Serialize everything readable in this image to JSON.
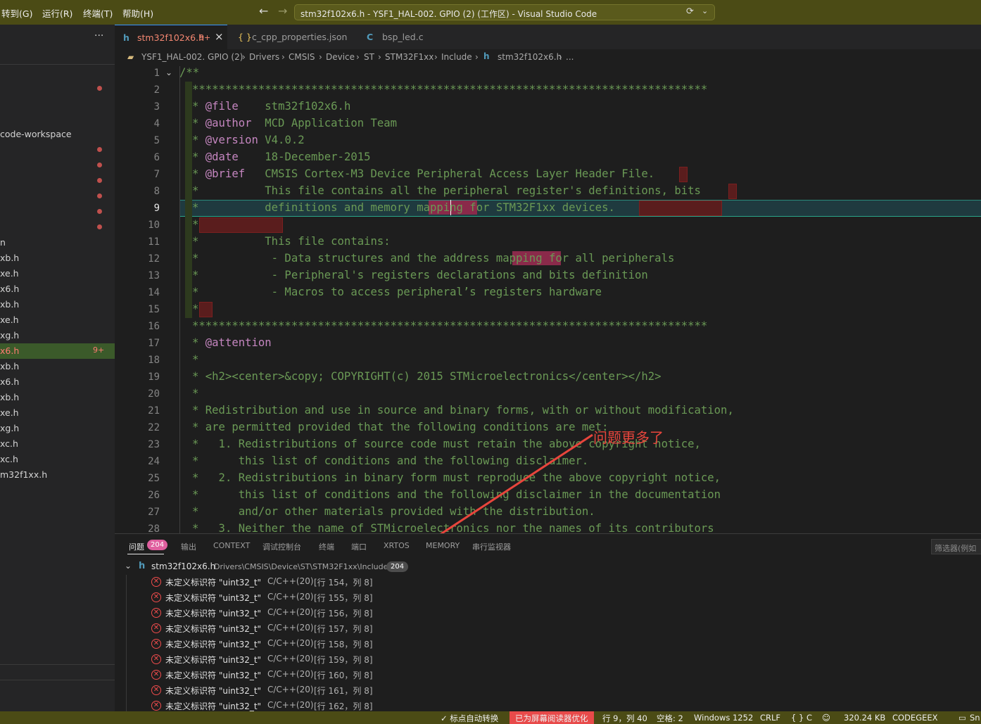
{
  "titlebar": {
    "menus": [
      "转到(G)",
      "运行(R)",
      "终端(T)",
      "帮助(H)"
    ],
    "window_title": "stm32f102x6.h - YSF1_HAL-002. GPIO (2) (工作区) - Visual Studio Code",
    "back_icon": "arrow-left-icon",
    "forward_icon": "arrow-right-icon"
  },
  "sidebar": {
    "more": "···",
    "workspace_label": "code-workspace",
    "files": [
      "n",
      "xb.h",
      "xe.h",
      "x6.h",
      "xb.h",
      "xe.h",
      "xg.h",
      "x6.h",
      "xb.h",
      "x6.h",
      "xb.h",
      "xe.h",
      "xg.h",
      "xc.h",
      "xc.h",
      "m32f1xx.h"
    ],
    "active_badge": "9+"
  },
  "tabs": [
    {
      "label": "stm32f102x6.h",
      "badge": "9+",
      "close": "×",
      "icon": "h"
    },
    {
      "label": "c_cpp_properties.json",
      "icon": "{ }"
    },
    {
      "label": "bsp_led.c",
      "icon": "C"
    }
  ],
  "breadcrumb": {
    "items": [
      "YSF1_HAL-002. GPIO (2)",
      "Drivers",
      "CMSIS",
      "Device",
      "ST",
      "STM32F1xx",
      "Include",
      "stm32f102x6.h",
      "..."
    ],
    "file_icon": "h"
  },
  "editor": {
    "line_numbers": [
      "1",
      "2",
      "3",
      "4",
      "5",
      "6",
      "7",
      "8",
      "9",
      "10",
      "11",
      "12",
      "13",
      "14",
      "15",
      "16",
      "17",
      "18",
      "19",
      "20",
      "21",
      "22",
      "23",
      "24",
      "25",
      "26",
      "27",
      "28"
    ],
    "lines": [
      "/**",
      "******************************************************************************",
      "* @file    stm32f102x6.h",
      "* @author  MCD Application Team",
      "* @version V4.0.2",
      "* @date    18-December-2015",
      "* @brief   CMSIS Cortex-M3 Device Peripheral Access Layer Header File.",
      "*          This file contains all the peripheral register's definitions, bits",
      "*          definitions and memory mapping for STM32F1xx devices.",
      "*",
      "*          This file contains:",
      "*           - Data structures and the address mapping for all peripherals",
      "*           - Peripheral's registers declarations and bits definition",
      "*           - Macros to access peripheral’s registers hardware",
      "*",
      "******************************************************************************",
      "* @attention",
      "*",
      "* <h2><center>&copy; COPYRIGHT(c) 2015 STMicroelectronics</center></h2>",
      "*",
      "* Redistribution and use in source and binary forms, with or without modification,",
      "* are permitted provided that the following conditions are met:",
      "*   1. Redistributions of source code must retain the above copyright notice,",
      "*      this list of conditions and the following disclaimer.",
      "*   2. Redistributions in binary form must reproduce the above copyright notice,",
      "*      this list of conditions and the following disclaimer in the documentation",
      "*      and/or other materials provided with the distribution.",
      "*   3. Neither the name of STMicroelectronics nor the names of its contributors"
    ],
    "fold_icon": "chevron-down-icon"
  },
  "annotation": {
    "text": "问题更多了",
    "color": "#e8453c"
  },
  "panel": {
    "tabs": [
      "问题",
      "输出",
      "CONTEXT",
      "调试控制台",
      "终端",
      "端口",
      "XRTOS",
      "MEMORY",
      "串行监视器"
    ],
    "problems_count": "204",
    "filter_placeholder": "筛选器(例如",
    "file_group": {
      "name": "stm32f102x6.h",
      "path": "Drivers\\CMSIS\\Device\\ST\\STM32F1xx\\Include",
      "count": "204"
    },
    "problems": [
      {
        "msg": "未定义标识符 \"uint32_t\"",
        "src": "C/C++(20)",
        "loc": "[行 154，列 8]"
      },
      {
        "msg": "未定义标识符 \"uint32_t\"",
        "src": "C/C++(20)",
        "loc": "[行 155，列 8]"
      },
      {
        "msg": "未定义标识符 \"uint32_t\"",
        "src": "C/C++(20)",
        "loc": "[行 156，列 8]"
      },
      {
        "msg": "未定义标识符 \"uint32_t\"",
        "src": "C/C++(20)",
        "loc": "[行 157，列 8]"
      },
      {
        "msg": "未定义标识符 \"uint32_t\"",
        "src": "C/C++(20)",
        "loc": "[行 158，列 8]"
      },
      {
        "msg": "未定义标识符 \"uint32_t\"",
        "src": "C/C++(20)",
        "loc": "[行 159，列 8]"
      },
      {
        "msg": "未定义标识符 \"uint32_t\"",
        "src": "C/C++(20)",
        "loc": "[行 160，列 8]"
      },
      {
        "msg": "未定义标识符 \"uint32_t\"",
        "src": "C/C++(20)",
        "loc": "[行 161，列 8]"
      },
      {
        "msg": "未定义标识符 \"uint32_t\"",
        "src": "C/C++(20)",
        "loc": "[行 162，列 8]"
      }
    ]
  },
  "statusbar": {
    "auto_convert": "✓ 标点自动转换",
    "screen_reader": "已为屏幕阅读器优化",
    "position": "行 9，列 40",
    "spaces": "空格: 2",
    "encoding": "Windows 1252",
    "eol": "CRLF",
    "language": "{ } C",
    "size": "320.24 KB",
    "codegeex": "CODEGEEX",
    "extra": "Sn"
  },
  "colors": {
    "titlebar_bg": "#4b4b15",
    "error_red": "#f14c4c",
    "badge_pink": "#e05f9f",
    "screen_reader_bg": "#e84a4a"
  }
}
